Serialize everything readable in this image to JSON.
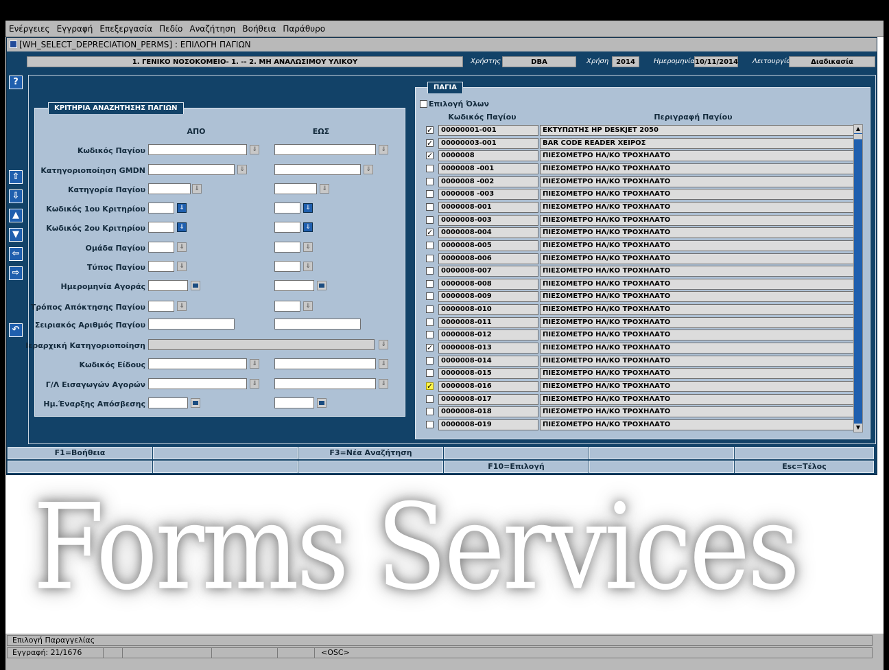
{
  "menu": [
    "Ενέργειες",
    "Εγγραφή",
    "Επεξεργασία",
    "Πεδίο",
    "Αναζήτηση",
    "Βοήθεια",
    "Παράθυρο"
  ],
  "window": {
    "title": "[WH_SELECT_DEPRECIATION_PERMS]  :  ΕΠΙΛΟΓΗ ΠΑΓΙΩΝ"
  },
  "header": {
    "org": "1. ΓΕΝΙΚΟ ΝΟΣΟΚΟΜΕΙΟ- 1. -- 2. ΜΗ ΑΝΑΛΩΣΙΜΟΥ ΥΛΙΚΟΥ",
    "user_label": "Χρήστης",
    "user": "DBA",
    "year_label": "Χρήση",
    "year": "2014",
    "date_label": "Ημερομηνία",
    "date": "10/11/2014",
    "function_label": "Λειτουργία",
    "function": "Διαδικασία"
  },
  "criteria": {
    "title": "ΚΡΙΤΗΡΙΑ ΑΝΑΖΗΤΗΣΗΣ ΠΑΓΙΩΝ",
    "from_label": "ΑΠΟ",
    "to_label": "ΕΩΣ",
    "labels": [
      "Κωδικός Παγίου",
      "Κατηγοριοποίηση GMDN",
      "Κατηγορία Παγίου",
      "Κωδικός 1ου Κριτηρίου",
      "Κωδικός 2ου Κριτηρίου",
      "Ομάδα Παγίου",
      "Τύπος Παγίου",
      "Ημερομηνία Αγοράς",
      "Τρόπος Απόκτησης Παγίου",
      "Σειριακός Αριθμός Παγίου",
      "Ιεραρχική Κατηγοριοποίηση",
      "Κωδικός Είδους",
      "Γ/Λ Εισαγωγών Αγορών",
      "Ημ.Έναρξης Απόσβεσης"
    ]
  },
  "assets": {
    "title": "ΠΑΓΙΑ",
    "select_all_label": "Επιλογή Όλων",
    "col_code": "Κωδικός Παγίου",
    "col_desc": "Περιγραφή Παγίου",
    "rows": [
      {
        "checked": true,
        "code": "00000001-001",
        "desc": "ΕΚΤΥΠΩΤΗΣ HP DESKJET 2050"
      },
      {
        "checked": true,
        "code": "00000003-001",
        "desc": "BAR CODE READER ΧΕΙΡΟΣ"
      },
      {
        "checked": true,
        "code": "0000008",
        "desc": "ΠΙΕΣΟΜΕΤΡΟ ΗΛ/ΚΟ ΤΡΟΧΗΛΑΤΟ"
      },
      {
        "checked": false,
        "code": "0000008 -001",
        "desc": "ΠΙΕΣΟΜΕΤΡΟ ΗΛ/ΚΟ ΤΡΟΧΗΛΑΤΟ"
      },
      {
        "checked": false,
        "code": "0000008 -002",
        "desc": "ΠΙΕΣΟΜΕΤΡΟ ΗΛ/ΚΟ ΤΡΟΧΗΛΑΤΟ"
      },
      {
        "checked": false,
        "code": "0000008 -003",
        "desc": "ΠΙΕΣΟΜΕΤΡΟ ΗΛ/ΚΟ ΤΡΟΧΗΛΑΤΟ"
      },
      {
        "checked": false,
        "code": "0000008-001",
        "desc": "ΠΙΕΣΟΜΕΤΡΟ ΗΛ/ΚΟ ΤΡΟΧΗΛΑΤΟ"
      },
      {
        "checked": false,
        "code": "0000008-003",
        "desc": "ΠΙΕΣΟΜΕΤΡΟ ΗΛ/ΚΟ ΤΡΟΧΗΛΑΤΟ"
      },
      {
        "checked": true,
        "code": "0000008-004",
        "desc": "ΠΙΕΣΟΜΕΤΡΟ ΗΛ/ΚΟ ΤΡΟΧΗΛΑΤΟ"
      },
      {
        "checked": false,
        "code": "0000008-005",
        "desc": "ΠΙΕΣΟΜΕΤΡΟ ΗΛ/ΚΟ ΤΡΟΧΗΛΑΤΟ"
      },
      {
        "checked": false,
        "code": "0000008-006",
        "desc": "ΠΙΕΣΟΜΕΤΡΟ ΗΛ/ΚΟ ΤΡΟΧΗΛΑΤΟ"
      },
      {
        "checked": false,
        "code": "0000008-007",
        "desc": "ΠΙΕΣΟΜΕΤΡΟ ΗΛ/ΚΟ ΤΡΟΧΗΛΑΤΟ"
      },
      {
        "checked": false,
        "code": "0000008-008",
        "desc": "ΠΙΕΣΟΜΕΤΡΟ ΗΛ/ΚΟ ΤΡΟΧΗΛΑΤΟ"
      },
      {
        "checked": false,
        "code": "0000008-009",
        "desc": "ΠΙΕΣΟΜΕΤΡΟ ΗΛ/ΚΟ ΤΡΟΧΗΛΑΤΟ"
      },
      {
        "checked": false,
        "code": "0000008-010",
        "desc": "ΠΙΕΣΟΜΕΤΡΟ ΗΛ/ΚΟ ΤΡΟΧΗΛΑΤΟ"
      },
      {
        "checked": false,
        "code": "0000008-011",
        "desc": "ΠΙΕΣΟΜΕΤΡΟ ΗΛ/ΚΟ ΤΡΟΧΗΛΑΤΟ"
      },
      {
        "checked": false,
        "code": "0000008-012",
        "desc": "ΠΙΕΣΟΜΕΤΡΟ ΗΛ/ΚΟ ΤΡΟΧΗΛΑΤΟ"
      },
      {
        "checked": true,
        "code": "0000008-013",
        "desc": "ΠΙΕΣΟΜΕΤΡΟ ΗΛ/ΚΟ ΤΡΟΧΗΛΑΤΟ"
      },
      {
        "checked": false,
        "code": "0000008-014",
        "desc": "ΠΙΕΣΟΜΕΤΡΟ ΗΛ/ΚΟ ΤΡΟΧΗΛΑΤΟ"
      },
      {
        "checked": false,
        "code": "0000008-015",
        "desc": "ΠΙΕΣΟΜΕΤΡΟ ΗΛ/ΚΟ ΤΡΟΧΗΛΑΤΟ"
      },
      {
        "checked": true,
        "code": "0000008-016",
        "desc": "ΠΙΕΣΟΜΕΤΡΟ ΗΛ/ΚΟ ΤΡΟΧΗΛΑΤΟ",
        "current": true
      },
      {
        "checked": false,
        "code": "0000008-017",
        "desc": "ΠΙΕΣΟΜΕΤΡΟ ΗΛ/ΚΟ ΤΡΟΧΗΛΑΤΟ"
      },
      {
        "checked": false,
        "code": "0000008-018",
        "desc": "ΠΙΕΣΟΜΕΤΡΟ ΗΛ/ΚΟ ΤΡΟΧΗΛΑΤΟ"
      },
      {
        "checked": false,
        "code": "0000008-019",
        "desc": "ΠΙΕΣΟΜΕΤΡΟ ΗΛ/ΚΟ ΤΡΟΧΗΛΑΤΟ"
      }
    ]
  },
  "fkeys": {
    "row1": [
      "F1=Βοήθεια",
      "",
      "F3=Νέα Αναζήτηση",
      "",
      "",
      ""
    ],
    "row2": [
      "",
      "",
      "",
      "F10=Επιλογή",
      "",
      "Esc=Τέλος"
    ]
  },
  "watermark": "Forms Services",
  "status": {
    "message": "Επιλογή Παραγγελίας",
    "record": "Εγγραφή: 21/1676",
    "osc": "<OSC>"
  },
  "icons": {
    "help": "help-icon",
    "arrow_up": "arrow-up-icon",
    "arrow_down": "arrow-down-icon",
    "prev": "triangle-up-icon",
    "next": "triangle-down-icon",
    "left": "arrow-left-icon",
    "right": "arrow-right-icon",
    "back": "return-icon"
  }
}
